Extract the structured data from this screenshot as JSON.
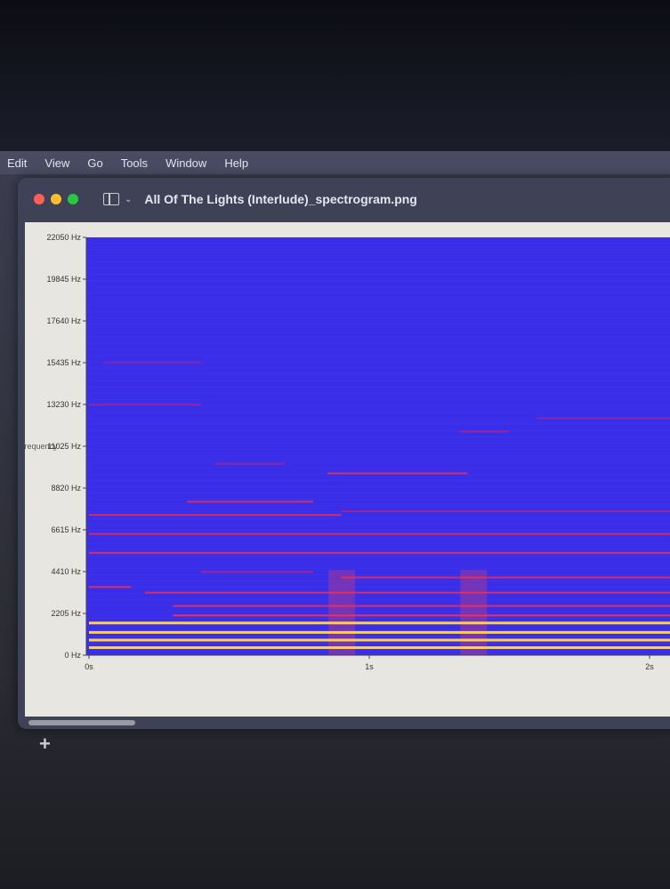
{
  "menu": [
    "Edit",
    "View",
    "Go",
    "Tools",
    "Window",
    "Help"
  ],
  "window": {
    "title": "All Of The Lights (Interlude)_spectrogram.png"
  },
  "colors": {
    "background": "#3a2ee8",
    "low": "#d0206a",
    "mid": "#ff3040",
    "high": "#ffd040"
  },
  "chart_data": {
    "type": "heatmap",
    "ylabel": "Frequency",
    "yticks": [
      "22050 Hz",
      "19845 Hz",
      "17640 Hz",
      "15435 Hz",
      "13230 Hz",
      "11025 Hz",
      "8820 Hz",
      "6615 Hz",
      "4410 Hz",
      "2205 Hz",
      "0 Hz"
    ],
    "ytick_values": [
      22050,
      19845,
      17640,
      15435,
      13230,
      11025,
      8820,
      6615,
      4410,
      2205,
      0
    ],
    "xticks": [
      "0s",
      "1s",
      "2s"
    ],
    "xtick_values": [
      0,
      1,
      2
    ],
    "xlim": [
      0,
      2.08
    ],
    "ylim": [
      0,
      22050
    ],
    "bands": [
      {
        "f": 400,
        "t0": 0,
        "t1": 2.08,
        "i": 0.9
      },
      {
        "f": 800,
        "t0": 0,
        "t1": 2.08,
        "i": 0.95
      },
      {
        "f": 1200,
        "t0": 0,
        "t1": 2.08,
        "i": 0.9
      },
      {
        "f": 1700,
        "t0": 0,
        "t1": 2.08,
        "i": 1
      },
      {
        "f": 2100,
        "t0": 0.3,
        "t1": 2.08,
        "i": 0.7
      },
      {
        "f": 2600,
        "t0": 0.3,
        "t1": 2.08,
        "i": 0.6
      },
      {
        "f": 3300,
        "t0": 0.2,
        "t1": 2.08,
        "i": 0.6
      },
      {
        "f": 3600,
        "t0": 0,
        "t1": 0.15,
        "i": 0.6
      },
      {
        "f": 4100,
        "t0": 0.9,
        "t1": 2.08,
        "i": 0.55
      },
      {
        "f": 4400,
        "t0": 0.4,
        "t1": 0.8,
        "i": 0.5
      },
      {
        "f": 5400,
        "t0": 0,
        "t1": 2.08,
        "i": 0.6
      },
      {
        "f": 6400,
        "t0": 0,
        "t1": 2.08,
        "i": 0.55
      },
      {
        "f": 7400,
        "t0": 0,
        "t1": 0.9,
        "i": 0.55
      },
      {
        "f": 8100,
        "t0": 0.35,
        "t1": 0.8,
        "i": 0.55
      },
      {
        "f": 7600,
        "t0": 0.9,
        "t1": 2.08,
        "i": 0.45
      },
      {
        "f": 9600,
        "t0": 0.85,
        "t1": 1.35,
        "i": 0.55
      },
      {
        "f": 10100,
        "t0": 0.45,
        "t1": 0.7,
        "i": 0.4
      },
      {
        "f": 13230,
        "t0": 0,
        "t1": 0.4,
        "i": 0.35
      },
      {
        "f": 11800,
        "t0": 1.32,
        "t1": 1.5,
        "i": 0.45
      },
      {
        "f": 15435,
        "t0": 0.05,
        "t1": 0.4,
        "i": 0.25
      },
      {
        "f": 12500,
        "t0": 1.6,
        "t1": 2.08,
        "i": 0.3
      }
    ],
    "onsets": [
      0.88,
      1.35
    ]
  }
}
